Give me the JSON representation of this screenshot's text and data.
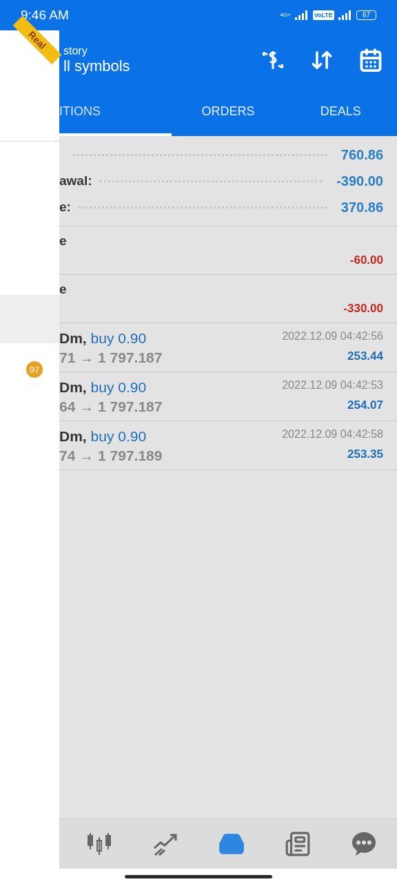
{
  "status_bar": {
    "time": "9:46 AM",
    "network": "4G+",
    "volte": "VoLTE",
    "battery": "67"
  },
  "drawer": {
    "ribbon": "Real",
    "badge": "97"
  },
  "header": {
    "title": "story",
    "subtitle": "ll symbols"
  },
  "tabs": [
    {
      "label": "ITIONS",
      "selected": true
    },
    {
      "label": "ORDERS",
      "selected": false
    },
    {
      "label": "DEALS",
      "selected": false
    }
  ],
  "summary": [
    {
      "value": "760.86"
    },
    {
      "label": "awal:",
      "value": "-390.00"
    },
    {
      "label": "e:",
      "value": "370.86"
    }
  ],
  "balances": [
    {
      "label": "e",
      "amount": "-60.00"
    },
    {
      "label": "e",
      "amount": "-330.00"
    }
  ],
  "deals": [
    {
      "symbol": "Dm,",
      "type": "buy 0.90",
      "prices": "71 → 1 797.187",
      "time": "2022.12.09 04:42:56",
      "profit": "253.44"
    },
    {
      "symbol": "Dm,",
      "type": "buy 0.90",
      "prices": "64 → 1 797.187",
      "time": "2022.12.09 04:42:53",
      "profit": "254.07"
    },
    {
      "symbol": "Dm,",
      "type": "buy 0.90",
      "prices": "74 → 1 797.189",
      "time": "2022.12.09 04:42:58",
      "profit": "253.35"
    }
  ],
  "nav": [
    {
      "kind": "quotes",
      "selected": false
    },
    {
      "kind": "trade",
      "selected": false
    },
    {
      "kind": "history",
      "selected": true
    },
    {
      "kind": "news",
      "selected": false
    },
    {
      "kind": "chat",
      "selected": false
    }
  ]
}
